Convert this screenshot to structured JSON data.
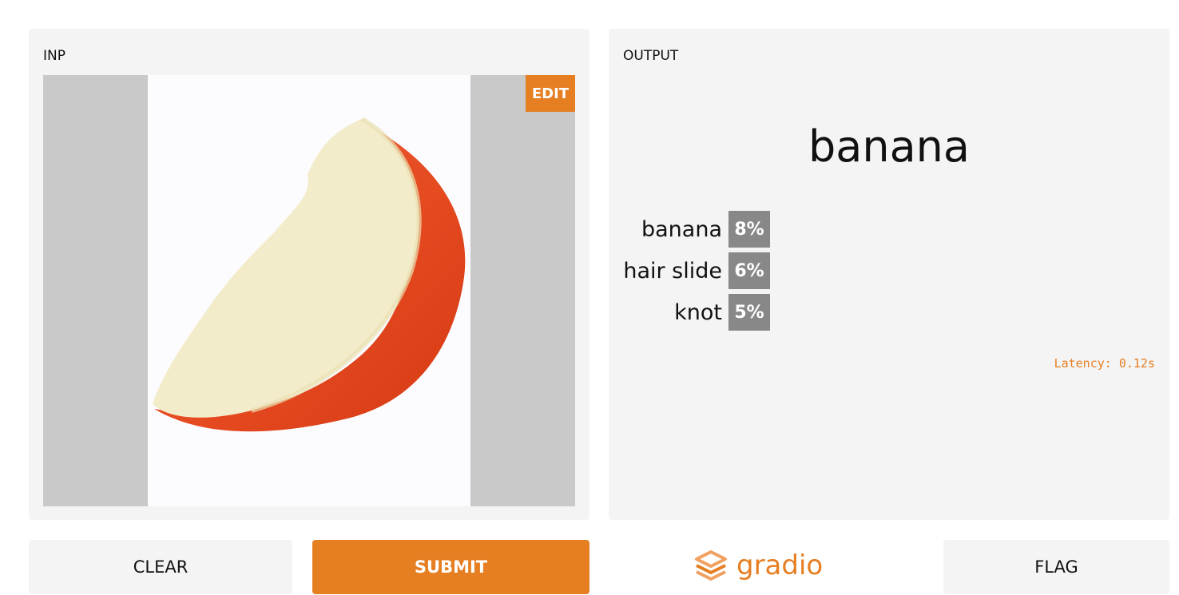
{
  "input": {
    "label": "INP",
    "edit_label": "EDIT"
  },
  "output": {
    "label": "OUTPUT",
    "prediction": "banana",
    "confidences": [
      {
        "label": "banana",
        "percent": "8%"
      },
      {
        "label": "hair slide",
        "percent": "6%"
      },
      {
        "label": "knot",
        "percent": "5%"
      }
    ],
    "latency": "Latency: 0.12s"
  },
  "buttons": {
    "clear": "CLEAR",
    "submit": "SUBMIT",
    "flag": "FLAG"
  },
  "brand": {
    "name": "gradio",
    "icon": "gradio-logo-icon"
  },
  "colors": {
    "accent": "#e67e22",
    "panel_bg": "#f4f4f4",
    "bar": "#888888"
  }
}
